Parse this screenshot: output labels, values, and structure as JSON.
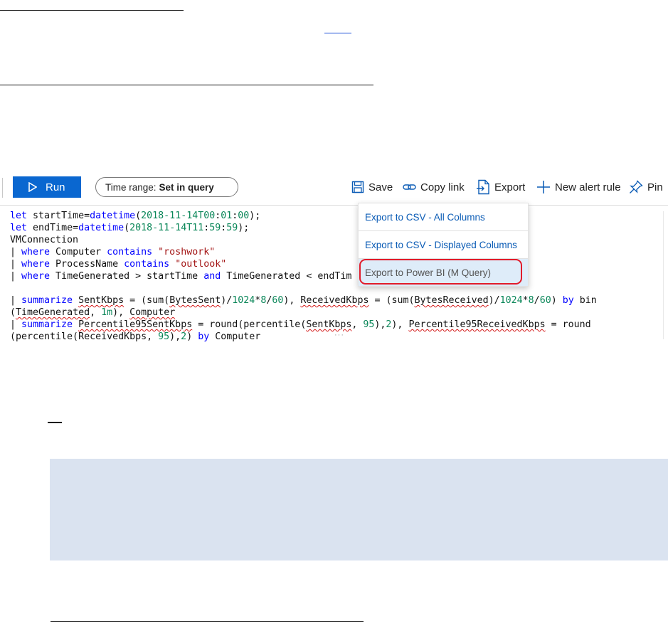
{
  "toolbar": {
    "run_label": "Run",
    "time_range_prefix": "Time range:",
    "time_range_value": "Set in query",
    "save_label": "Save",
    "copy_link_label": "Copy link",
    "export_label": "Export",
    "new_alert_rule_label": "New alert rule",
    "pin_label": "Pin"
  },
  "export_menu": {
    "items": [
      {
        "label": "Export to CSV - All Columns"
      },
      {
        "label": "Export to CSV - Displayed Columns"
      },
      {
        "label": "Export to Power BI (M Query)"
      }
    ],
    "selected_index": 2
  },
  "query": {
    "lines": [
      "let startTime=datetime(2018-11-14T00:01:00);",
      "let endTime=datetime(2018-11-14T11:59:59);",
      "VMConnection",
      "| where Computer contains \"roshwork\"",
      "| where ProcessName contains \"outlook\"",
      "| where TimeGenerated > startTime and TimeGenerated < endTim",
      "",
      "| summarize SentKbps = (sum(BytesSent)/1024*8/60), ReceivedKbps = (sum(BytesReceived)/1024*8/60) by bin",
      "(TimeGenerated, 1m), Computer",
      "| summarize Percentile95SentKbps = round(percentile(SentKbps, 95),2), Percentile95ReceivedKbps = round",
      "(percentile(ReceivedKbps, 95),2) by Computer"
    ]
  },
  "colors": {
    "run_button": "#0a67d0",
    "menu_link": "#0a5bb5",
    "selected_item_bg": "#deecf9",
    "highlight_ring": "#e21b2a",
    "note_background": "#dae3f0",
    "keyword": "#0000ff",
    "string": "#a31515",
    "number": "#098658"
  }
}
